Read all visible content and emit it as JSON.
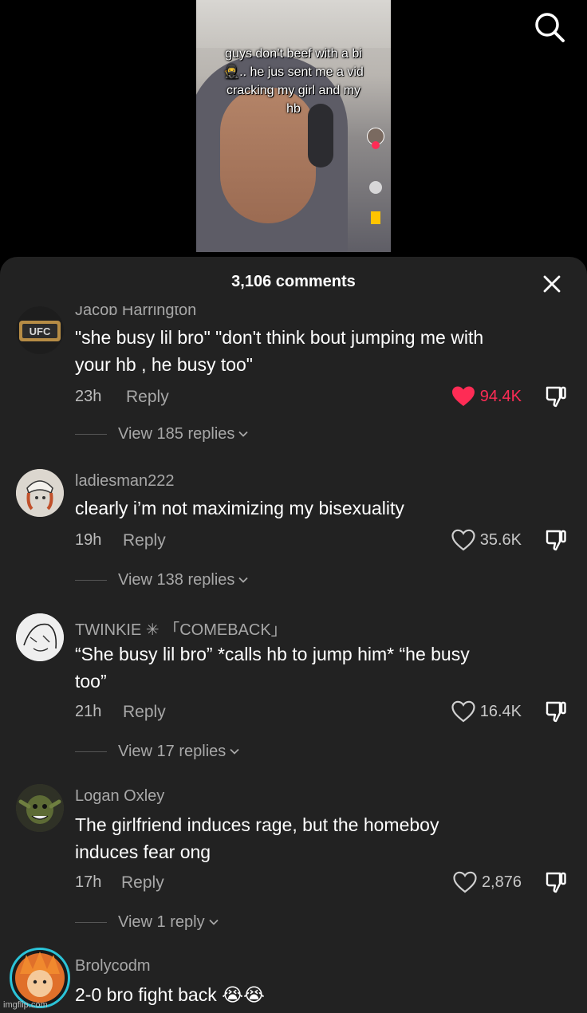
{
  "video": {
    "caption_lines": [
      "guys don’t beef with a bi",
      "🥷.. he jus sent me a vid",
      "cracking my girl and my",
      "hb"
    ]
  },
  "sheet": {
    "title": "3,106 comments"
  },
  "comments": [
    {
      "username": "Jacob Harrington",
      "text_lines": [
        "\"she busy lil bro\" \"don't think bout jumping me with",
        "your hb , he busy too\""
      ],
      "time": "23h",
      "reply_label": "Reply",
      "likes": "94.4K",
      "liked": true,
      "view_replies": "View 185 replies",
      "avatar_color": "#b68c45"
    },
    {
      "username": "ladiesman222",
      "text_lines": [
        "clearly i’m not maximizing my bisexuality"
      ],
      "time": "19h",
      "reply_label": "Reply",
      "likes": "35.6K",
      "liked": false,
      "view_replies": "View 138 replies",
      "avatar_color": "#d8d3cc"
    },
    {
      "username": "TWINKIE ✳ 「COMEBACK」",
      "text_lines": [
        "“She busy lil bro” *calls hb to jump him* “he busy",
        "too”"
      ],
      "time": "21h",
      "reply_label": "Reply",
      "likes": "16.4K",
      "liked": false,
      "view_replies": "View 17 replies",
      "avatar_color": "#e5e5e5"
    },
    {
      "username": "Logan Oxley",
      "text_lines": [
        "The girlfriend induces rage, but the homeboy",
        "induces fear ong"
      ],
      "time": "17h",
      "reply_label": "Reply",
      "likes": "2,876",
      "liked": false,
      "view_replies": "View 1 reply",
      "avatar_color": "#4a5a2c"
    },
    {
      "username": "Brolycodm",
      "text_lines": [
        "2-0 bro fight back 😭😭"
      ],
      "avatar_color": "#e0702a"
    }
  ],
  "watermark": "imgflip.com",
  "colors": {
    "sheet_bg": "#222222",
    "like_red": "#fe2c55",
    "muted_text": "#a8a8a8"
  },
  "icons": [
    "search-icon",
    "close-icon",
    "heart-icon",
    "dislike-icon",
    "chevron-down-icon",
    "ufc-badge-icon"
  ]
}
